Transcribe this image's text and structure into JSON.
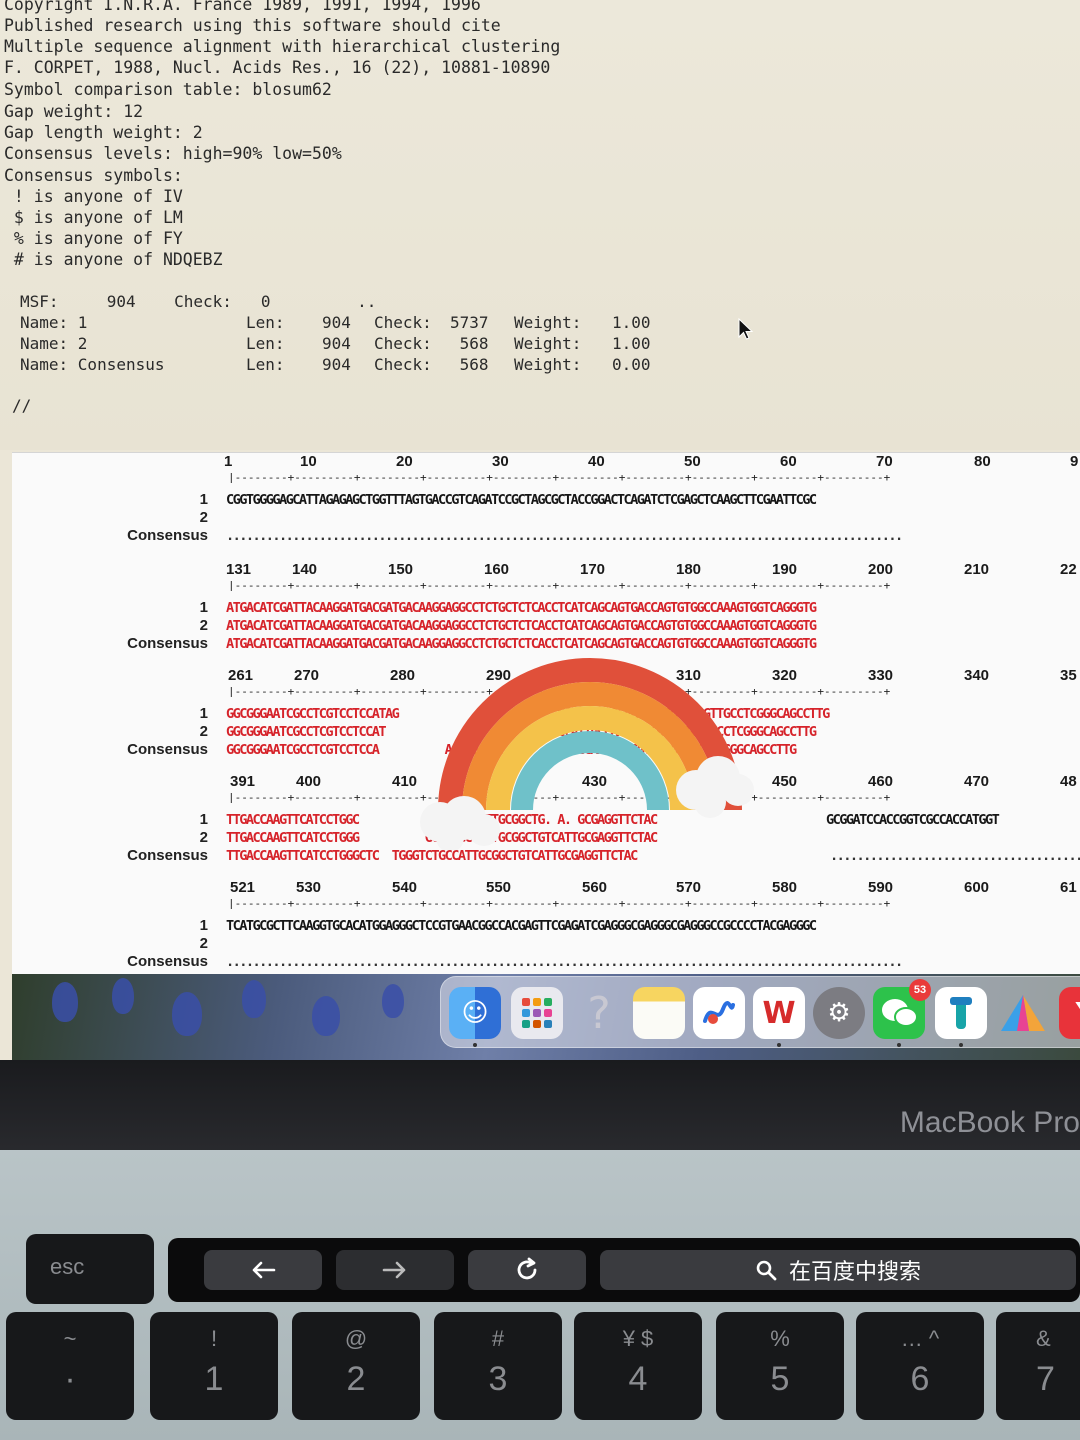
{
  "header_lines": [
    "Copyright I.N.R.A. France 1989, 1991, 1994, 1996",
    "Published research using this software should cite",
    "Multiple sequence alignment with hierarchical clustering",
    "F. CORPET, 1988, Nucl. Acids Res., 16 (22), 10881-10890",
    "Symbol comparison table: blosum62",
    "Gap weight: 12",
    "Gap length weight: 2",
    "Consensus levels: high=90% low=50%",
    "Consensus symbols:",
    " ! is anyone of IV",
    " $ is anyone of LM",
    " % is anyone of FY",
    " # is anyone of NDQEBZ"
  ],
  "msf": {
    "line0": "MSF:     904    Check:   0         ..",
    "rows": [
      {
        "name": "Name: 1",
        "len": "Len:",
        "len_value": "904",
        "check": "Check:",
        "check_value": "5737",
        "weight": "Weight:",
        "weight_value": "1.00"
      },
      {
        "name": "Name: 2",
        "len": "Len:",
        "len_value": "904",
        "check": "Check:",
        "check_value": " 568",
        "weight": "Weight:",
        "weight_value": "1.00"
      },
      {
        "name": "Name: Consensus",
        "len": "Len:",
        "len_value": "904",
        "check": "Check:",
        "check_value": " 568",
        "weight": "Weight:",
        "weight_value": "0.00"
      }
    ],
    "terminator": "//"
  },
  "alignment": {
    "labels": {
      "seq1": "1",
      "seq2": "2",
      "consensus": "Consensus"
    },
    "blocks": [
      {
        "numbers": [
          "1",
          "10",
          "20",
          "30",
          "40",
          "50",
          "60",
          "70",
          "80",
          "9"
        ],
        "seq1": "CGGTGGGGAGCATTAGAGAGCTGGTTTAGTGACCGTCAGATCCGCTAGCGCTACCGGACTCAGATCTCGAGCTCAAGCTTCGAATTCGC",
        "seq2": "",
        "consensus": "......................................................................................................",
        "color": "black"
      },
      {
        "numbers": [
          "131",
          "140",
          "150",
          "160",
          "170",
          "180",
          "190",
          "200",
          "210",
          "22"
        ],
        "seq1": "ATGACATCGATTACAAGGATGACGATGACAAGGAGGCCTCTGCTCTCACCTCATCAGCAGTGACCAGTGTGGCCAAAGTGGTCAGGGTG",
        "seq2": "ATGACATCGATTACAAGGATGACGATGACAAGGAGGCCTCTGCTCTCACCTCATCAGCAGTGACCAGTGTGGCCAAAGTGGTCAGGGTG",
        "consensus": "ATGACATCGATTACAAGGATGACGATGACAAGGAGGCCTCTGCTCTCACCTCATCAGCAGTGACCAGTGTGGCCAAAGTGGTCAGGGTG",
        "color": "red"
      },
      {
        "numbers": [
          "261",
          "270",
          "280",
          "290",
          "",
          "310",
          "320",
          "330",
          "340",
          "35"
        ],
        "seq1": "GGCGGGAATCGCCTCGTCCTCCATAG                        GGCCATTGCCAATGGGGGTGGAGTTGCCTCGGGCAGCCTTG",
        "seq2": "GGCGGGAATCGCCTCGTCCTCCAT                          CCATTGCCAATGGGGGTGGAGTTGCCTCGGGCAGCCTTG",
        "consensus": "GGCGGGAATCGCCTCGTCCTCCA          AGATGATGT       ATTGCCAATGGGGGTGGAGTTGCCTCGGGCAGCCTTG",
        "color": "red"
      },
      {
        "numbers": [
          "391",
          "400",
          "410",
          "0",
          "430",
          "",
          "450",
          "460",
          "470",
          "48"
        ],
        "seq1": "TTGACCAAGTTCATCCTGGC          GGTCTGCCATTGCGGCTG. A. GCGAGGTTCTAC",
        "seq1_tail": "GCGGATCCACCGGTCGCCACCATGGT",
        "seq2": "TTGACCAAGTTCATCCTGGG          GGTCTGCCATTGCGGCTGTCATTGCGAGGTTCTAC",
        "consensus": "TTGACCAAGTTCATCCTGGGCTC  TGGGTCTGCCATTGCGGCTGTCATTGCGAGGTTCTAC",
        "consensus_tail": "............................................",
        "color": "red"
      },
      {
        "numbers": [
          "521",
          "530",
          "540",
          "550",
          "560",
          "570",
          "580",
          "590",
          "600",
          "61"
        ],
        "seq1": "TCATGCGCTTCAAGGTGCACATGGAGGGCTCCGTGAACGGCCACGAGTTCGAGATCGAGGGCGAGGGCGAGGGCCGCCCCTACGAGGGC",
        "seq2": "",
        "consensus": "......................................................................................................",
        "color": "black"
      }
    ]
  },
  "dock": {
    "apps": [
      {
        "icon": "finder-icon",
        "color": "#3d8be6"
      },
      {
        "icon": "launchpad-icon",
        "color": "#e8e8ee"
      },
      {
        "icon": "help-icon",
        "color": "transparent"
      },
      {
        "icon": "notes-icon",
        "color": "#f7d560"
      },
      {
        "icon": "freeform-icon",
        "color": "#ffffff"
      },
      {
        "icon": "wps-icon",
        "color": "#ffffff"
      },
      {
        "icon": "settings-icon",
        "color": "#8e8e93"
      },
      {
        "icon": "wechat-icon",
        "color": "#2dc24b",
        "badge": "53"
      },
      {
        "icon": "app-icon",
        "color": "#ffffff"
      },
      {
        "icon": "prism-icon",
        "color": "#ffffff"
      },
      {
        "icon": "app-red-icon",
        "color": "#e8333a"
      }
    ]
  },
  "laptop": {
    "brand": "MacBook Pro",
    "touchbar": {
      "search_label": "在百度中搜索"
    },
    "keys": [
      {
        "top": "",
        "bottom": "esc"
      },
      {
        "top": "!",
        "bottom": "1"
      },
      {
        "top": "@",
        "bottom": "2"
      },
      {
        "top": "#",
        "bottom": "3"
      },
      {
        "top": "¥  $",
        "bottom": "4"
      },
      {
        "top": "%",
        "bottom": "5"
      },
      {
        "top": "…  ^",
        "bottom": "6"
      },
      {
        "top": "&",
        "bottom": "7"
      }
    ],
    "tilde_key": {
      "top": "~",
      "bottom": "·"
    }
  }
}
